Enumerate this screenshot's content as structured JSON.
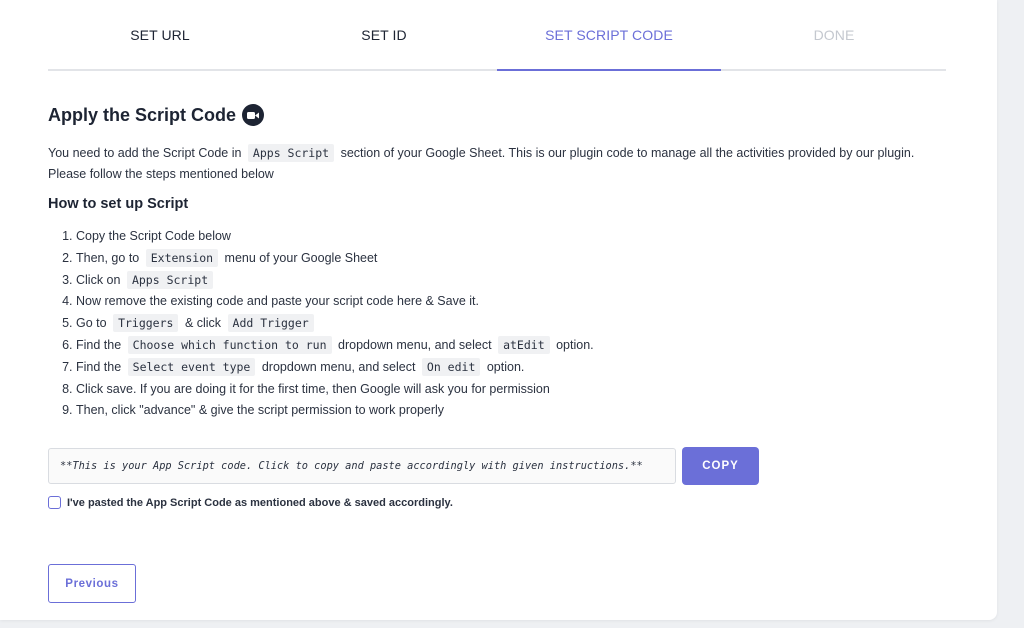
{
  "steps": [
    {
      "label": "SET URL",
      "state": "done"
    },
    {
      "label": "SET ID",
      "state": "done"
    },
    {
      "label": "SET SCRIPT CODE",
      "state": "active"
    },
    {
      "label": "DONE",
      "state": "disabled"
    }
  ],
  "section": {
    "title": "Apply the Script Code",
    "title_icon": "video-camera-icon",
    "intro_before": "You need to add the Script Code in",
    "intro_code": "Apps Script",
    "intro_after": "section of your Google Sheet. This is our plugin code to manage all the activities provided by our plugin. Please follow the steps mentioned below"
  },
  "howto": {
    "title": "How to set up Script",
    "steps": [
      {
        "pre": "Copy the Script Code below"
      },
      {
        "pre": "Then, go to",
        "code1": "Extension",
        "mid": "menu of your Google Sheet"
      },
      {
        "pre": "Click on",
        "code1": "Apps Script"
      },
      {
        "pre": "Now remove the existing code and paste your script code here & Save it."
      },
      {
        "pre": "Go to",
        "code1": "Triggers",
        "mid": "& click",
        "code2": "Add Trigger"
      },
      {
        "pre": "Find the",
        "code1": "Choose which function to run",
        "mid": "dropdown menu, and select",
        "code2": "atEdit",
        "post": "option."
      },
      {
        "pre": "Find the",
        "code1": "Select event type",
        "mid": "dropdown menu, and select",
        "code2": "On edit",
        "post": "option."
      },
      {
        "pre": "Click save. If you are doing it for the first time, then Google will ask you for permission"
      },
      {
        "pre": "Then, click \"advance\" & give the script permission to work properly"
      }
    ]
  },
  "code_box": {
    "text": "**This is your App Script code. Click to copy and paste accordingly with given instructions.**"
  },
  "buttons": {
    "copy": "COPY",
    "previous": "Previous"
  },
  "confirm": {
    "label": "I've pasted the App Script Code as mentioned above & saved accordingly.",
    "checked": false
  },
  "colors": {
    "accent": "#6b6fd8",
    "disabled": "#c4c8cf",
    "text": "#1d2433"
  }
}
